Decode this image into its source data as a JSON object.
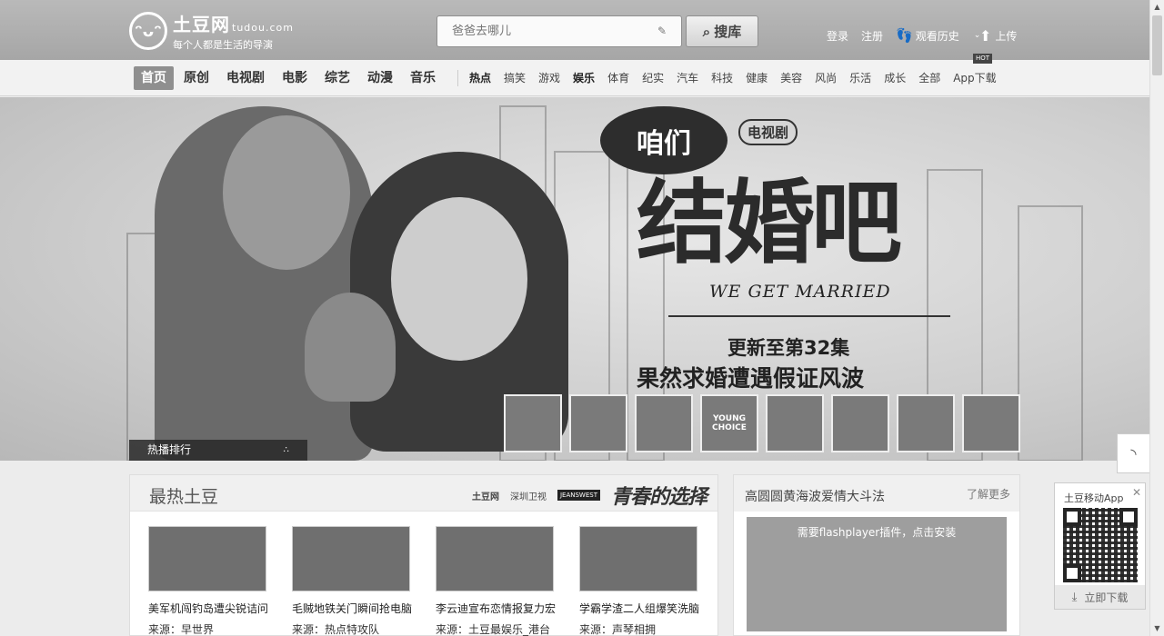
{
  "header": {
    "logo_text": "土豆网",
    "logo_domain": "tudou.com",
    "logo_slogan": "每个人都是生活的导演",
    "search_placeholder": "爸爸去哪儿",
    "search_button": "搜库",
    "login": "登录",
    "register": "注册",
    "history": "观看历史",
    "upload": "上传"
  },
  "nav": {
    "main": [
      {
        "label": "首页",
        "active": true
      },
      {
        "label": "原创"
      },
      {
        "label": "电视剧"
      },
      {
        "label": "电影"
      },
      {
        "label": "综艺"
      },
      {
        "label": "动漫"
      },
      {
        "label": "音乐"
      }
    ],
    "sub": [
      "热点",
      "搞笑",
      "游戏",
      "娱乐",
      "体育",
      "纪实",
      "汽车",
      "科技",
      "健康",
      "美容",
      "风尚",
      "乐活",
      "成长",
      "全部",
      "App下载"
    ],
    "hot_badge": "HOT"
  },
  "banner": {
    "bubble": "咱们",
    "tag": "电视剧",
    "title": "结婚吧",
    "title_en": "WE GET MARRIED",
    "episode": "更新至第32集",
    "plot": "果然求婚遭遇假证风波",
    "rank_label": "热播排行",
    "thumbs": [
      "",
      "",
      "",
      "YOUNG CHOICE",
      "",
      "",
      "",
      ""
    ]
  },
  "hot": {
    "title": "最热土豆",
    "sponsors": [
      "土豆网",
      "深圳卫视",
      "JEANSWEST",
      "青春的选择"
    ],
    "videos": [
      {
        "title": "美军机闯钓岛遭尖锐诘问",
        "source": "来源：早世界"
      },
      {
        "title": "毛贼地铁关门瞬间抢电脑",
        "source": "来源：热点特攻队"
      },
      {
        "title": "李云迪宣布恋情报复力宏",
        "source": "来源：土豆最娱乐_港台"
      },
      {
        "title": "学霸学渣二人组爆笑洗脑",
        "source": "来源：声琴相拥"
      }
    ]
  },
  "ad_panel": {
    "title": "高圆圆黄海波爱情大斗法",
    "more": "了解更多",
    "flash_msg": "需要flashplayer插件，点击安装"
  },
  "app_box": {
    "title": "土豆移动App",
    "download": "立即下载"
  }
}
